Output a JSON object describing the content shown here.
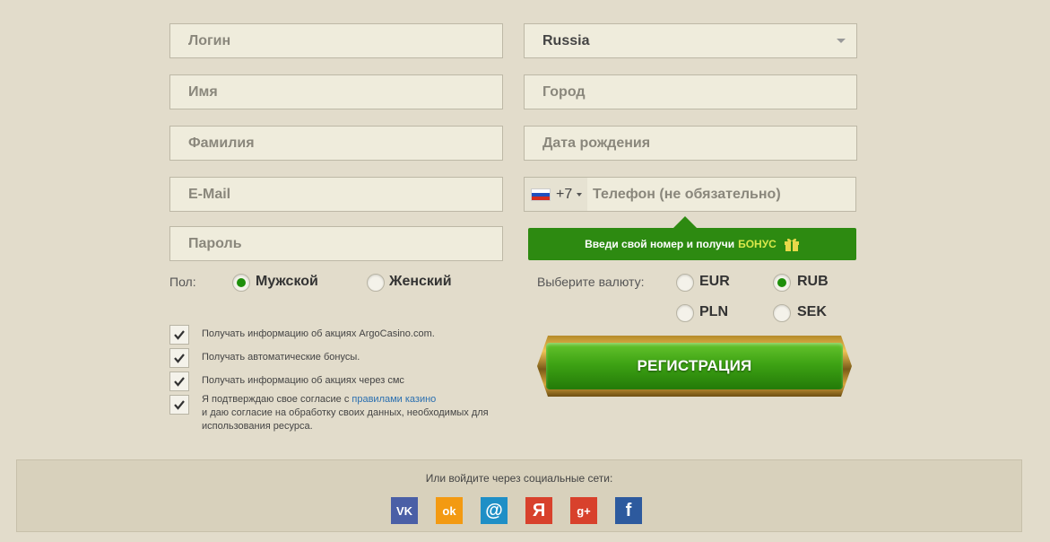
{
  "form": {
    "login_placeholder": "Логин",
    "name_placeholder": "Имя",
    "surname_placeholder": "Фамилия",
    "email_placeholder": "E-Mail",
    "password_placeholder": "Пароль",
    "country_value": "Russia",
    "city_placeholder": "Город",
    "birthdate_placeholder": "Дата рождения",
    "phone_prefix": "+7",
    "phone_placeholder": "Телефон (не обязательно)"
  },
  "bonus": {
    "text": "Введи свой номер и получи",
    "highlight": "БОНУС",
    "highlight_color": "#d8e84a"
  },
  "gender": {
    "label": "Пол:",
    "options": [
      "Мужской",
      "Женский"
    ],
    "selected": "Мужской"
  },
  "currency": {
    "label": "Выберите валюту:",
    "options": [
      "EUR",
      "RUB",
      "PLN",
      "SEK"
    ],
    "selected": "RUB"
  },
  "checkboxes": [
    {
      "label": "Получать информацию об акциях ArgoCasino.com.",
      "checked": true
    },
    {
      "label": "Получать автоматические бонусы.",
      "checked": true
    },
    {
      "label": "Получать информацию об акциях через смс",
      "checked": true
    },
    {
      "label_before": "Я подтверждаю свое согласие с",
      "link": "правилами казино",
      "label_after": "и даю согласие на обработку своих данных, необходимых для использования ресурса.",
      "checked": true
    }
  ],
  "register_button": "РЕГИСТРАЦИЯ",
  "social": {
    "title": "Или войдите через социальные сети:",
    "networks": [
      {
        "name": "vk-icon",
        "glyph": "VK",
        "color": "#4a5fa6"
      },
      {
        "name": "odnoklassniki-icon",
        "glyph": "ok",
        "color": "#f39a12"
      },
      {
        "name": "mailru-icon",
        "glyph": "@",
        "color": "#1f8fc6"
      },
      {
        "name": "yandex-icon",
        "glyph": "Я",
        "color": "#d8412c"
      },
      {
        "name": "google-plus-icon",
        "glyph": "g+",
        "color": "#d8412c"
      },
      {
        "name": "facebook-icon",
        "glyph": "f",
        "color": "#2d5a9e"
      }
    ]
  },
  "colors": {
    "accent_green": "#2d8a11",
    "background": "#e2dccb"
  }
}
